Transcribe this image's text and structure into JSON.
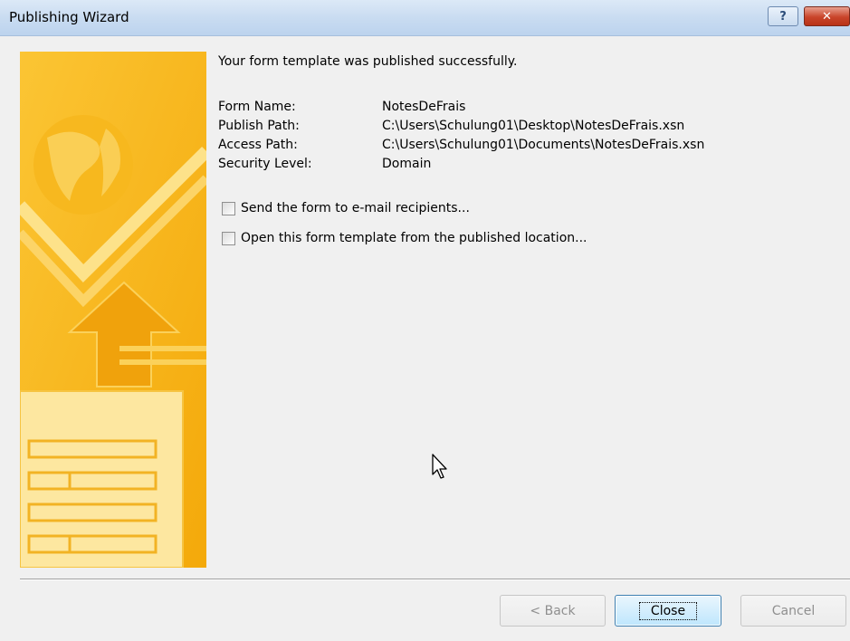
{
  "window": {
    "title": "Publishing Wizard",
    "help_glyph": "?",
    "close_glyph": "✕"
  },
  "content": {
    "headline": "Your form template was published successfully.",
    "info": [
      {
        "label": "Form Name:",
        "value": "NotesDeFrais"
      },
      {
        "label": "Publish Path:",
        "value": "C:\\Users\\Schulung01\\Desktop\\NotesDeFrais.xsn"
      },
      {
        "label": "Access Path:",
        "value": "C:\\Users\\Schulung01\\Documents\\NotesDeFrais.xsn"
      },
      {
        "label": "Security Level:",
        "value": "Domain"
      }
    ],
    "checkboxes": [
      {
        "label": "Send the form to e-mail recipients...",
        "checked": false
      },
      {
        "label": "Open this form template from the published location...",
        "checked": false
      }
    ]
  },
  "buttons": {
    "back": "< Back",
    "close": "Close",
    "cancel": "Cancel"
  },
  "colors": {
    "art_base": "#f6b71a",
    "art_light": "#fde28a",
    "titlebar": "#c9dcf1"
  }
}
